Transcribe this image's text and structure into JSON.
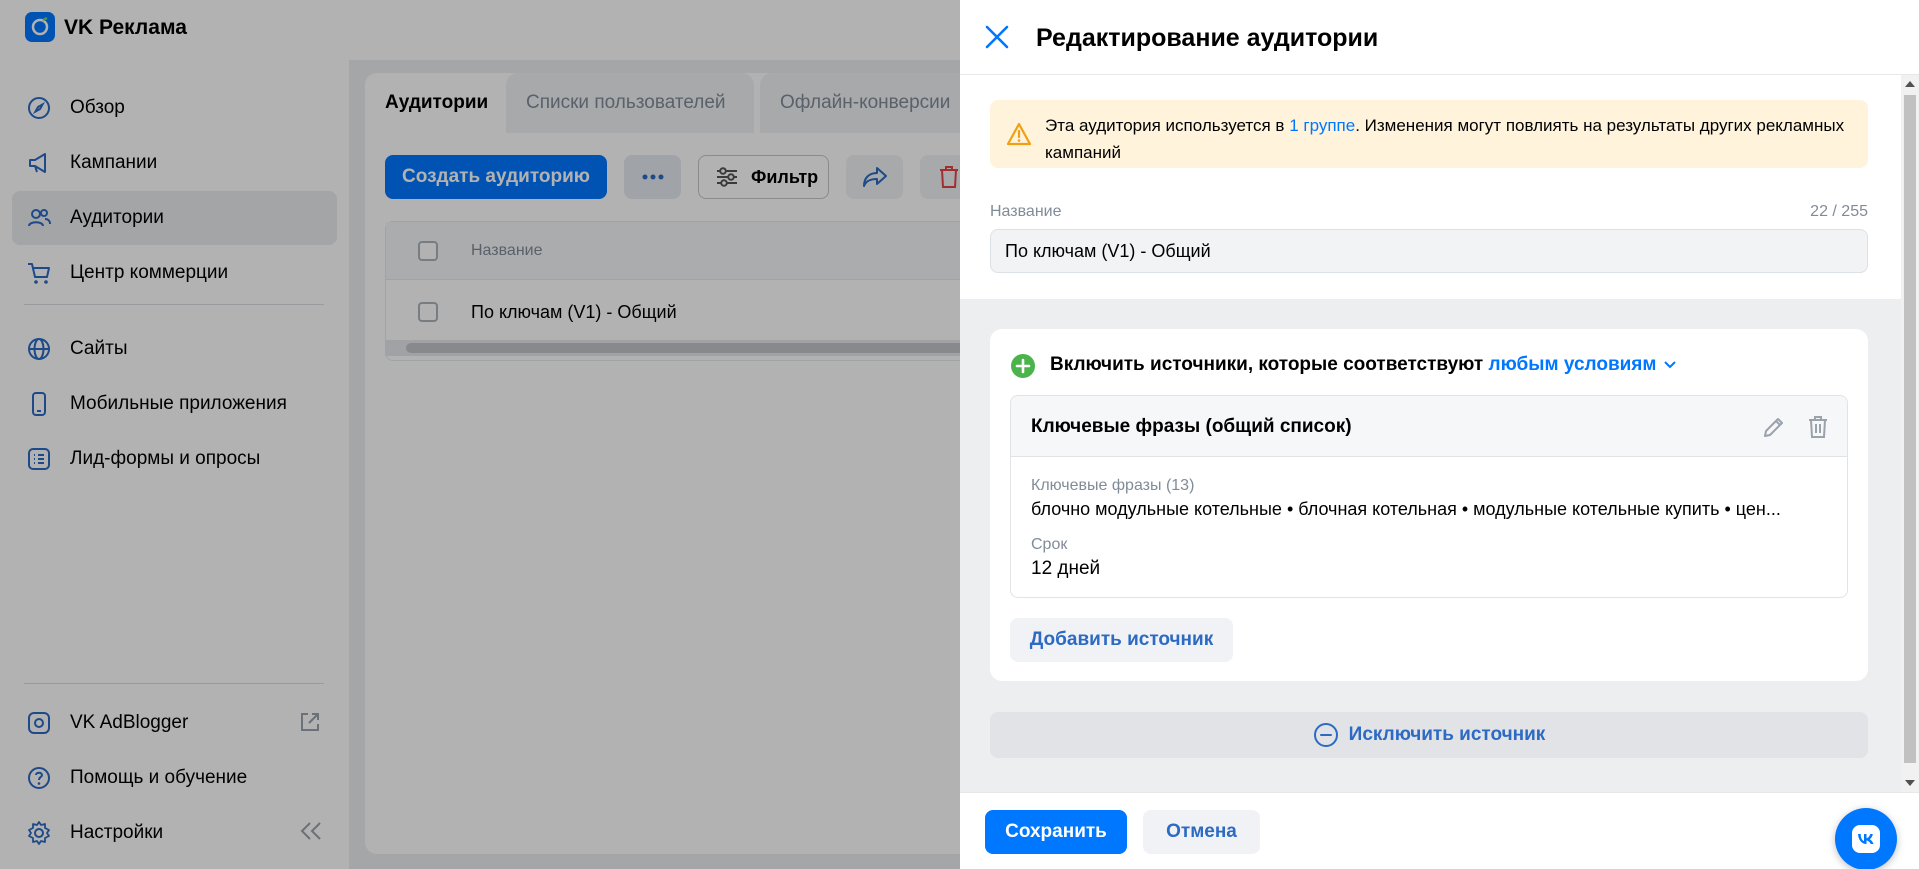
{
  "app": {
    "brand": "VK Реклама",
    "colors": {
      "accent": "#0077ff",
      "link": "#2c6ac4",
      "warning_bg": "#fff3dc",
      "success": "#4bb34b"
    }
  },
  "sidebar": {
    "items": [
      {
        "label": "Обзор",
        "icon": "compass-icon"
      },
      {
        "label": "Кампании",
        "icon": "megaphone-icon"
      },
      {
        "label": "Аудитории",
        "icon": "users-icon",
        "active": true
      },
      {
        "label": "Центр коммерции",
        "icon": "cart-icon"
      },
      {
        "label": "Сайты",
        "icon": "globe-icon"
      },
      {
        "label": "Мобильные приложения",
        "icon": "phone-icon"
      },
      {
        "label": "Лид-формы и опросы",
        "icon": "list-icon"
      }
    ],
    "bottom": [
      {
        "label": "VK AdBlogger",
        "icon": "adblogger-icon"
      },
      {
        "label": "Помощь и обучение",
        "icon": "help-icon"
      },
      {
        "label": "Настройки",
        "icon": "gear-icon"
      }
    ]
  },
  "main": {
    "tabs": [
      "Аудитории",
      "Списки пользователей",
      "Офлайн-конверсии"
    ],
    "create_label": "Создать аудиторию",
    "filter_label": "Фильтр",
    "table": {
      "header_name": "Название",
      "rows": [
        "По ключам (V1) - Общий"
      ]
    }
  },
  "modal": {
    "title": "Редактирование аудитории",
    "warning": {
      "prefix": "Эта аудитория используется в ",
      "link": "1 группе",
      "suffix": ". Изменения могут повлиять на результаты других рекламных кампаний"
    },
    "name_field": {
      "label": "Название",
      "counter": "22 / 255",
      "value": "По ключам (V1) - Общий"
    },
    "include": {
      "prefix": "Включить источники, которые соответствуют ",
      "condition": "любым условиям"
    },
    "source": {
      "title": "Ключевые фразы (общий список)",
      "keywords_label": "Ключевые фразы (13)",
      "keywords_value": "блочно модульные котельные • блочная котельная • модульные котельные купить • цен...",
      "period_label": "Срок",
      "period_value": "12 дней"
    },
    "add_source_label": "Добавить источник",
    "exclude_label": "Исключить источник",
    "save_label": "Сохранить",
    "cancel_label": "Отмена"
  }
}
